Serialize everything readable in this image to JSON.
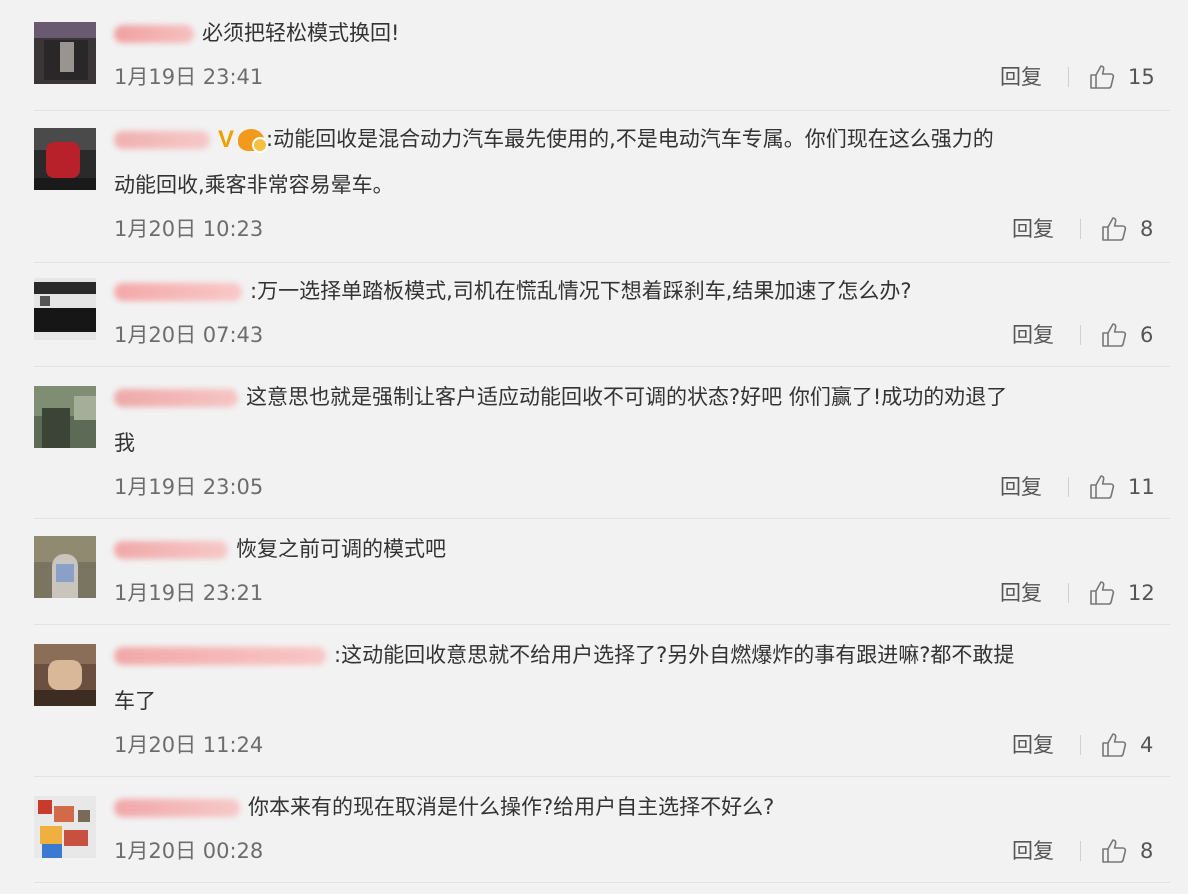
{
  "reply_label": "回复",
  "comments": [
    {
      "text": "必须把轻松模式换回!",
      "text2": "",
      "time": "1月19日 23:41",
      "likes": "15",
      "badge": false
    },
    {
      "text": ":动能回收是混合动力汽车最先使用的,不是电动汽车专属。你们现在这么强力的",
      "text2": "动能回收,乘客非常容易晕车。",
      "time": "1月20日 10:23",
      "likes": "8",
      "badge": true
    },
    {
      "text": ":万一选择单踏板模式,司机在慌乱情况下想着踩刹车,结果加速了怎么办?",
      "text2": "",
      "time": "1月20日 07:43",
      "likes": "6",
      "badge": false
    },
    {
      "text": "这意思也就是强制让客户适应动能回收不可调的状态?好吧 你们赢了!成功的劝退了",
      "text2": "我",
      "time": "1月19日 23:05",
      "likes": "11",
      "badge": false
    },
    {
      "text": "恢复之前可调的模式吧",
      "text2": "",
      "time": "1月19日 23:21",
      "likes": "12",
      "badge": false
    },
    {
      "text": ":这动能回收意思就不给用户选择了?另外自燃爆炸的事有跟进嘛?都不敢提",
      "text2": "车了",
      "time": "1月20日 11:24",
      "likes": "4",
      "badge": false
    },
    {
      "text": "你本来有的现在取消是什么操作?给用户自主选择不好么?",
      "text2": "",
      "time": "1月20日 00:28",
      "likes": "8",
      "badge": false
    }
  ]
}
